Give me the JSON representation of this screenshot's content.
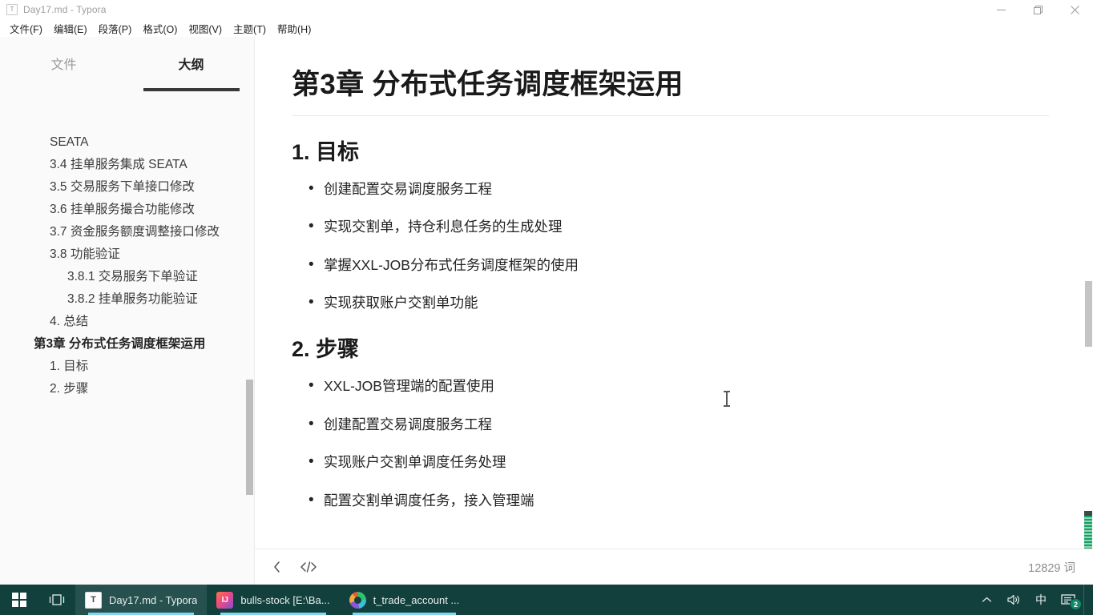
{
  "window": {
    "title": "Day17.md - Typora",
    "app_icon": "T",
    "controls": {
      "minimize": "minimize-icon",
      "restore": "restore-icon",
      "close": "close-icon"
    }
  },
  "menubar": {
    "items": [
      {
        "label": "文件(F)",
        "name": "menu-file"
      },
      {
        "label": "编辑(E)",
        "name": "menu-edit"
      },
      {
        "label": "段落(P)",
        "name": "menu-paragraph"
      },
      {
        "label": "格式(O)",
        "name": "menu-format"
      },
      {
        "label": "视图(V)",
        "name": "menu-view"
      },
      {
        "label": "主题(T)",
        "name": "menu-theme"
      },
      {
        "label": "帮助(H)",
        "name": "menu-help"
      }
    ]
  },
  "sidebar": {
    "tabs": [
      {
        "label": "文件",
        "active": false
      },
      {
        "label": "大纲",
        "active": true
      }
    ],
    "outline": [
      {
        "label": "SEATA",
        "level": 2
      },
      {
        "label": "3.4 挂单服务集成 SEATA",
        "level": 2
      },
      {
        "label": "3.5 交易服务下单接口修改",
        "level": 2
      },
      {
        "label": "3.6 挂单服务撮合功能修改",
        "level": 2
      },
      {
        "label": "3.7 资金服务额度调整接口修改",
        "level": 2
      },
      {
        "label": "3.8 功能验证",
        "level": 2
      },
      {
        "label": "3.8.1 交易服务下单验证",
        "level": 3
      },
      {
        "label": "3.8.2 挂单服务功能验证",
        "level": 3
      },
      {
        "label": "4. 总结",
        "level": 2
      },
      {
        "label": "第3章 分布式任务调度框架运用",
        "level": 1
      },
      {
        "label": "1. 目标",
        "level": 2
      },
      {
        "label": "2. 步骤",
        "level": 2
      }
    ]
  },
  "document": {
    "h1": "第3章 分布式任务调度框架运用",
    "sections": [
      {
        "heading": "1. 目标",
        "items": [
          "创建配置交易调度服务工程",
          "实现交割单，持仓利息任务的生成处理",
          "掌握XXL-JOB分布式任务调度框架的使用",
          "实现获取账户交割单功能"
        ]
      },
      {
        "heading": "2. 步骤",
        "items": [
          "XXL-JOB管理端的配置使用",
          "创建配置交易调度服务工程",
          "实现账户交割单调度任务处理",
          "配置交割单调度任务，接入管理端"
        ]
      }
    ]
  },
  "statusbar": {
    "back_icon": "back-chevron-icon",
    "source_icon": "source-code-icon",
    "word_count": "12829 词"
  },
  "taskbar": {
    "start": "windows-start-icon",
    "task_view": "task-view-icon",
    "apps": [
      {
        "label": "Day17.md - Typora",
        "icon": "typora-icon",
        "active": true
      },
      {
        "label": "bulls-stock [E:\\Ba...",
        "icon": "intellij-idea-icon",
        "active": false
      },
      {
        "label": "t_trade_account ...",
        "icon": "datagrip-icon",
        "active": false
      }
    ],
    "tray": {
      "chevron": "chevron-up-icon",
      "volume": "speaker-icon",
      "ime": "中",
      "notifications_badge": "2"
    }
  },
  "colors": {
    "sidebar_bg": "#fafafa",
    "content_bg": "#ffffff",
    "taskbar_bg": "#11403d",
    "accent_green": "#1d9c63",
    "text_primary": "#232323"
  }
}
